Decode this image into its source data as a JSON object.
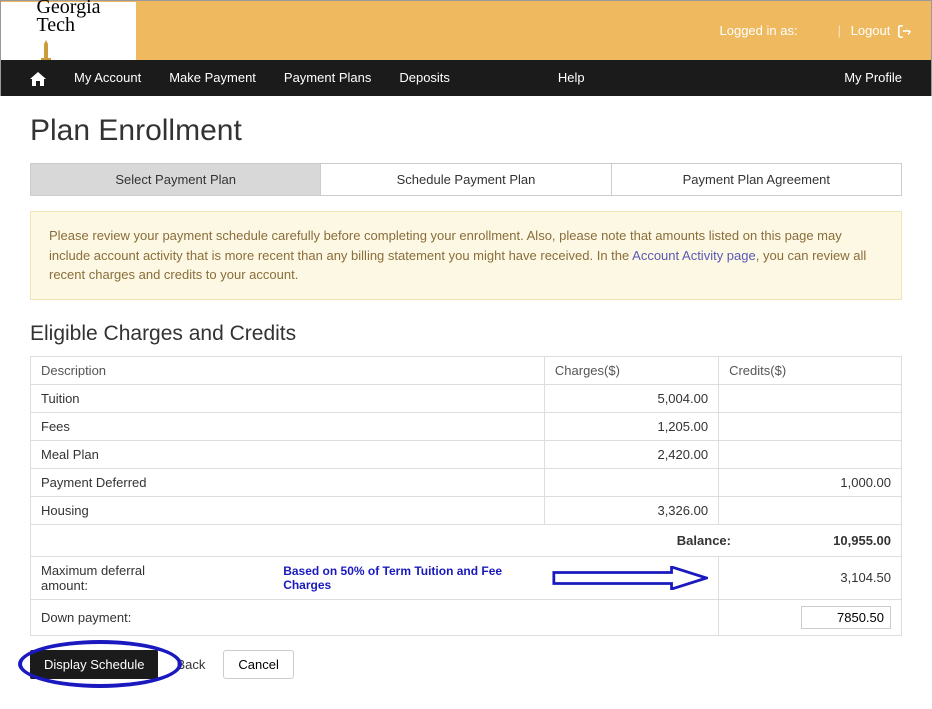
{
  "topbar": {
    "logged_in_label": "Logged in as:",
    "logout_label": "Logout"
  },
  "logo": {
    "line1": "Georgia",
    "line2": "Tech"
  },
  "nav": {
    "my_account": "My Account",
    "make_payment": "Make Payment",
    "payment_plans": "Payment Plans",
    "deposits": "Deposits",
    "help": "Help",
    "my_profile": "My Profile"
  },
  "page": {
    "title": "Plan Enrollment"
  },
  "steps": {
    "select": "Select Payment Plan",
    "schedule": "Schedule Payment Plan",
    "agreement": "Payment Plan Agreement"
  },
  "notice": {
    "pre": "Please review your payment schedule carefully before completing your enrollment. Also, please note that amounts listed on this page may include account activity that is more recent than any billing statement you might have received. In the ",
    "link": "Account Activity page",
    "post": ", you can review all recent charges and credits to your account."
  },
  "section": {
    "eligible": "Eligible Charges and Credits"
  },
  "table": {
    "headers": {
      "desc": "Description",
      "charges": "Charges($)",
      "credits": "Credits($)"
    },
    "rows": [
      {
        "desc": "Tuition",
        "charges": "5,004.00",
        "credits": ""
      },
      {
        "desc": "Fees",
        "charges": "1,205.00",
        "credits": ""
      },
      {
        "desc": "Meal Plan",
        "charges": "2,420.00",
        "credits": ""
      },
      {
        "desc": "Payment Deferred",
        "charges": "",
        "credits": "1,000.00"
      },
      {
        "desc": "Housing",
        "charges": "3,326.00",
        "credits": ""
      }
    ],
    "balance_label": "Balance:",
    "balance_value": "10,955.00",
    "deferral_label": "Maximum deferral amount:",
    "deferral_note": "Based on 50% of Term Tuition and Fee Charges",
    "deferral_value": "3,104.50",
    "down_label": "Down payment:",
    "down_value": "7850.50"
  },
  "buttons": {
    "display": "Display Schedule",
    "back": "Back",
    "cancel": "Cancel"
  }
}
